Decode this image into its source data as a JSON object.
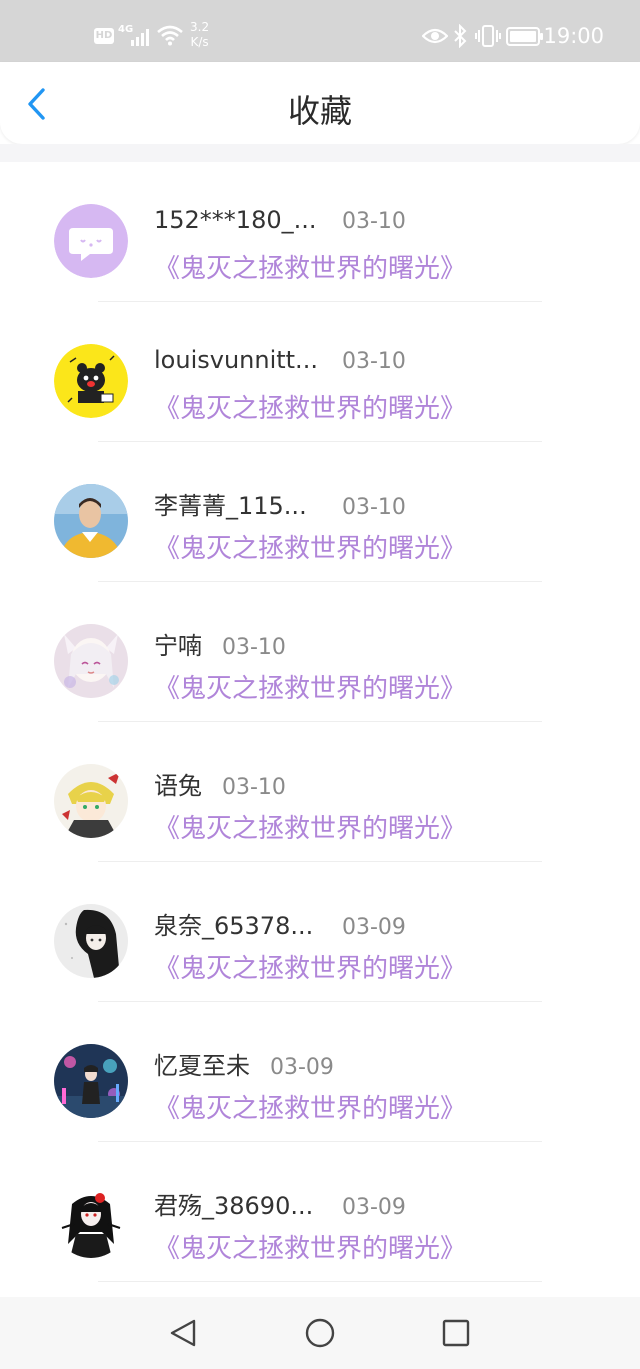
{
  "status_bar": {
    "hd": "HD",
    "network": "4G",
    "speed_value": "3.2",
    "speed_unit": "K/s",
    "time": "19:00"
  },
  "header": {
    "title": "收藏",
    "back_icon": "chevron-left-icon"
  },
  "colors": {
    "accent": "#2196f3",
    "subtitle": "#b085d9",
    "date": "#8a8a8a"
  },
  "favorites": [
    {
      "name": "152***180_...",
      "date": "03-10",
      "book": "《鬼灭之拯救世界的曙光》"
    },
    {
      "name": "louisvunnitt...",
      "date": "03-10",
      "book": "《鬼灭之拯救世界的曙光》"
    },
    {
      "name": "李菁菁_115...",
      "date": "03-10",
      "book": "《鬼灭之拯救世界的曙光》"
    },
    {
      "name": "宁喃",
      "date": "03-10",
      "book": "《鬼灭之拯救世界的曙光》"
    },
    {
      "name": "语兔",
      "date": "03-10",
      "book": "《鬼灭之拯救世界的曙光》"
    },
    {
      "name": "泉奈_65378...",
      "date": "03-09",
      "book": "《鬼灭之拯救世界的曙光》"
    },
    {
      "name": "忆夏至未",
      "date": "03-09",
      "book": "《鬼灭之拯救世界的曙光》"
    },
    {
      "name": "君殇_38690...",
      "date": "03-09",
      "book": "《鬼灭之拯救世界的曙光》"
    }
  ],
  "nav_bar": {
    "back": "triangle-back-icon",
    "home": "circle-home-icon",
    "recents": "square-recents-icon"
  }
}
